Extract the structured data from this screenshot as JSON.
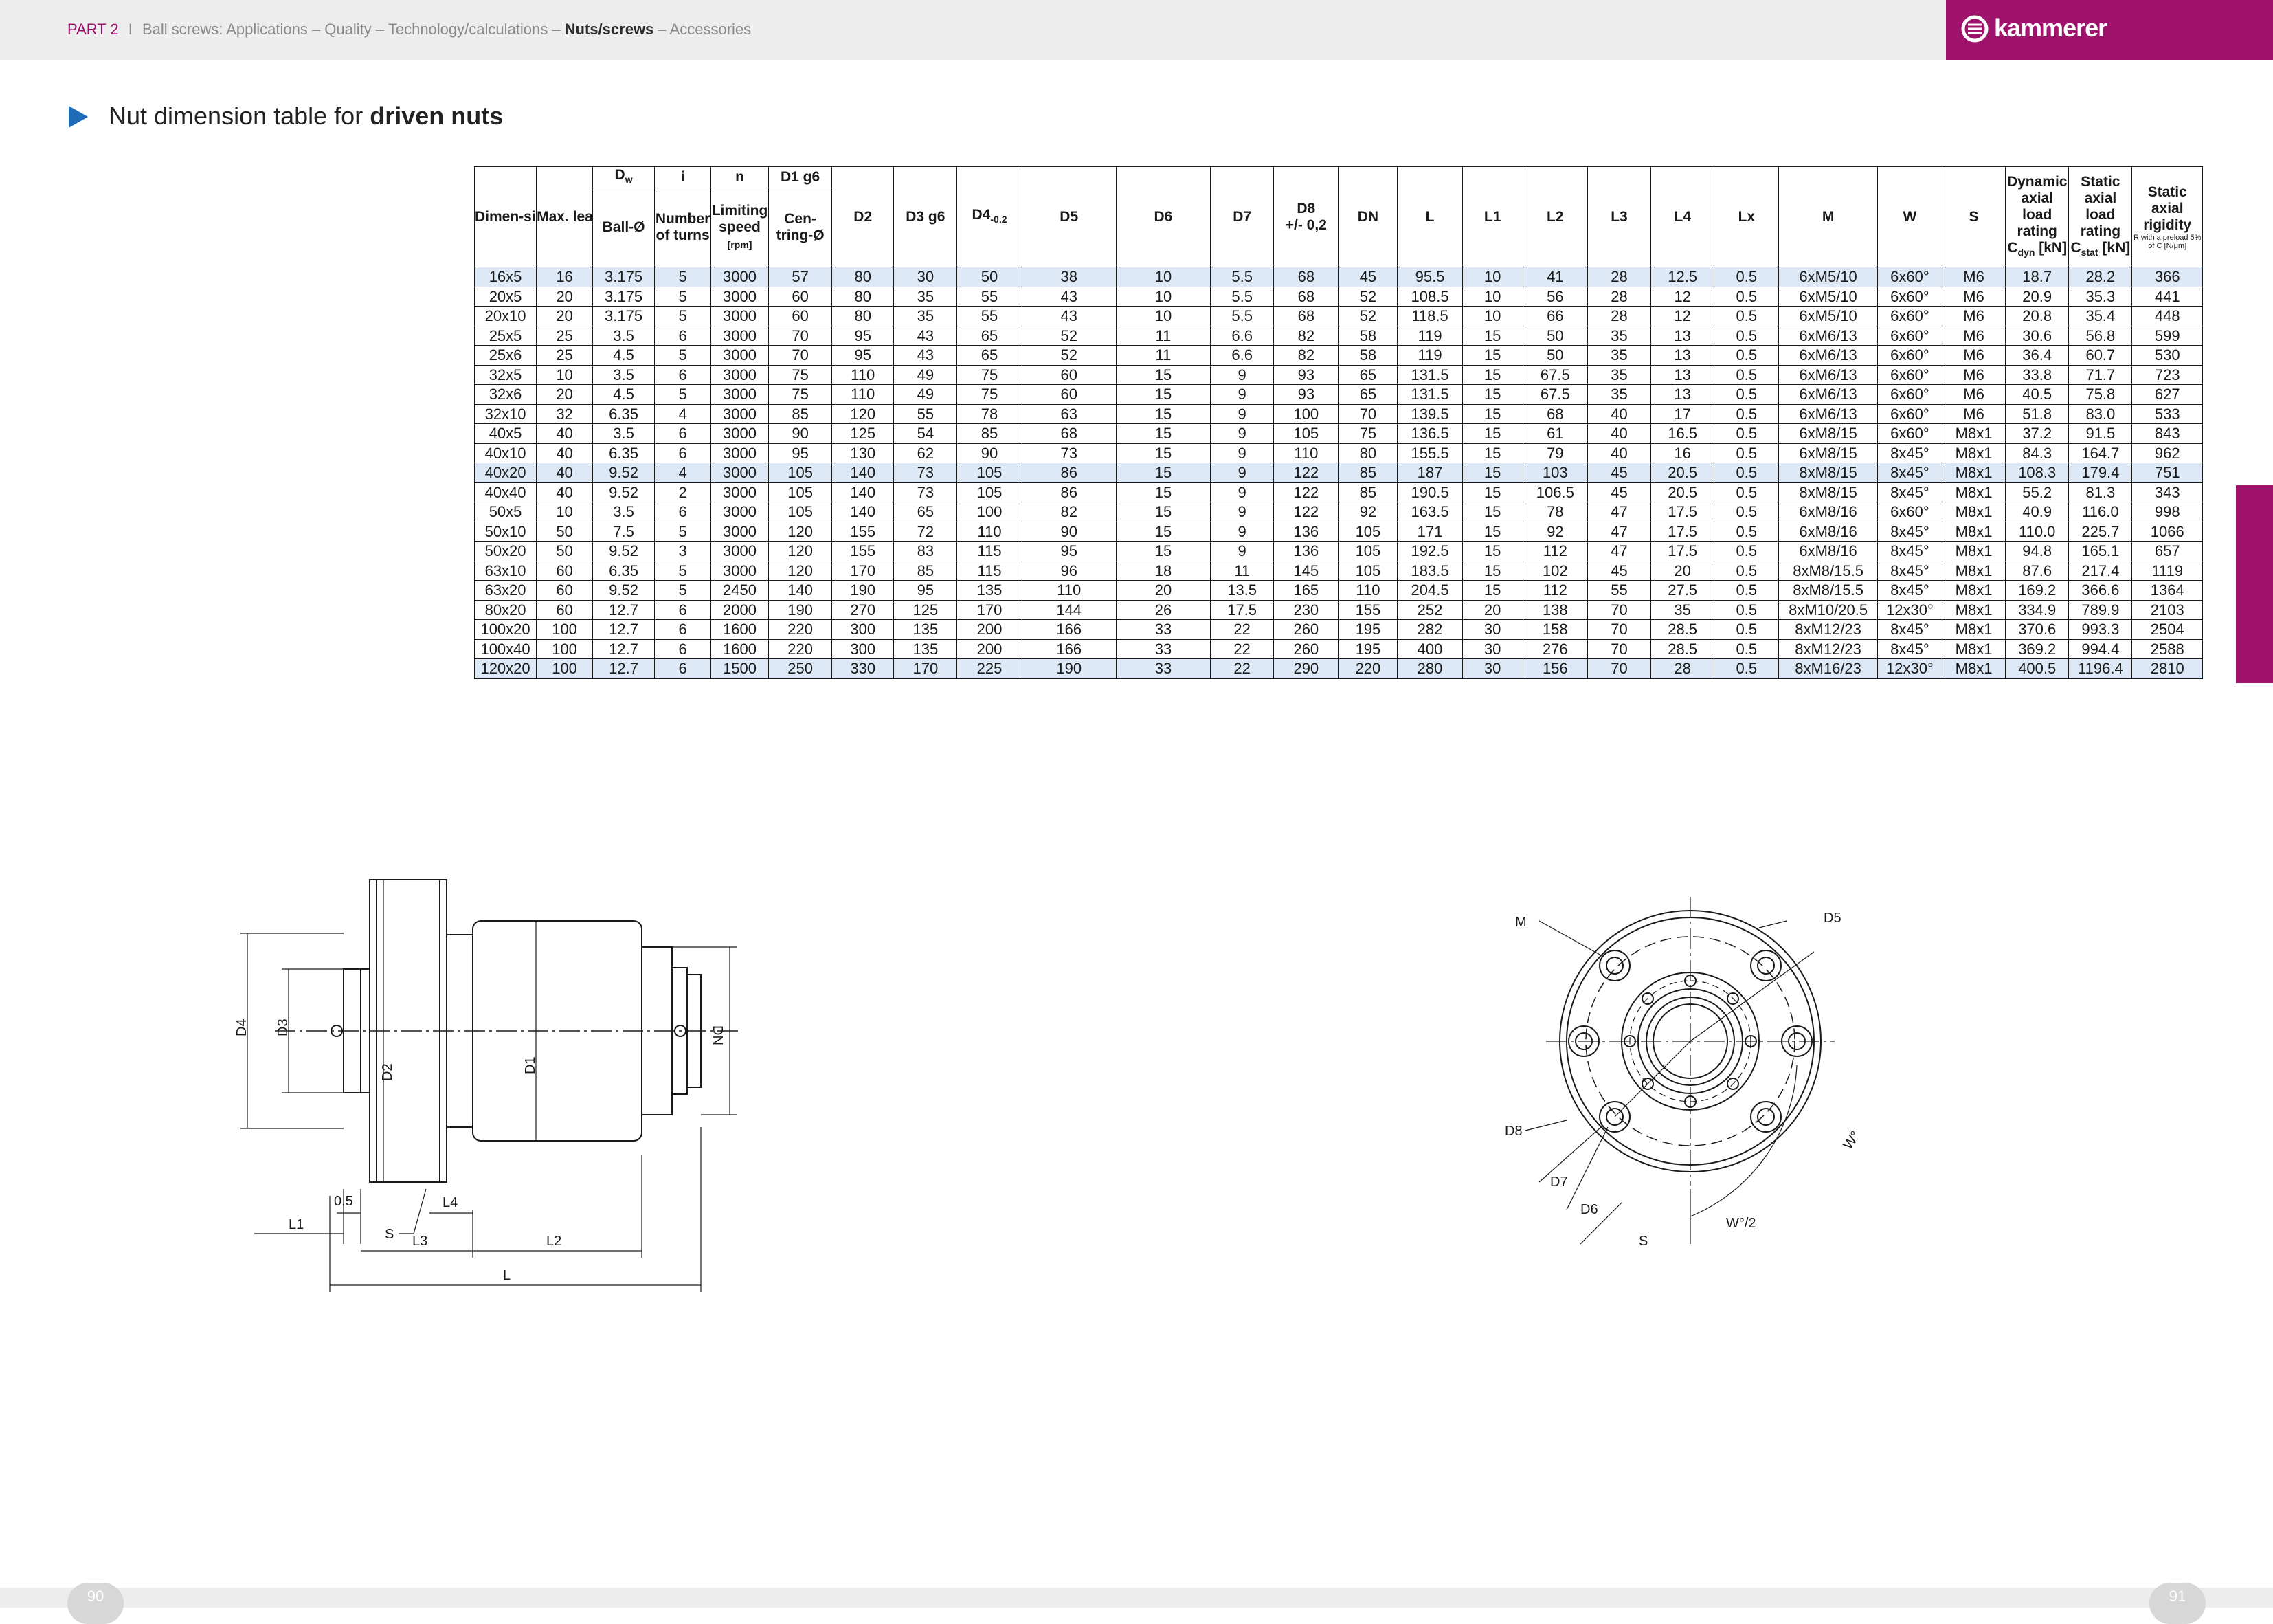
{
  "header": {
    "part": "PART 2",
    "separator": "I",
    "crumbs_lead": "Ball screws: Applications – Quality – Technology/calculations – ",
    "active": "Nuts/screws",
    "crumbs_tail": " – Accessories",
    "logo_text": "kammerer",
    "brand_color": "#a0136d"
  },
  "title": {
    "prefix": "Nut dimension table for ",
    "bold": "driven nuts"
  },
  "table": {
    "group_headers": {
      "dw": "D",
      "dw_sub": "w",
      "i": "i",
      "n": "n",
      "d1": "D1 g6"
    },
    "headers": {
      "dimensions": "Dimen-sions",
      "max_lead": "Max. lead",
      "ball": "Ball-Ø",
      "turns": "Number of turns",
      "speed": "Limiting speed",
      "speed_unit": "[rpm]",
      "centring": "Cen-tring-Ø",
      "d2": "D2",
      "d3": "D3 g6",
      "d4": "D4",
      "d4_sub": "-0.2",
      "d5": "D5",
      "d6": "D6",
      "d7": "D7",
      "d8": "D8",
      "d8_tol": "+/- 0,2",
      "dn": "DN",
      "l": "L",
      "l1": "L1",
      "l2": "L2",
      "l3": "L3",
      "l4": "L4",
      "lx": "Lx",
      "m": "M",
      "w": "W",
      "s": "S",
      "dyn": "Dynamic axial load rating",
      "dyn_unit": "C",
      "dyn_sub": "dyn",
      "dyn_unit2": " [kN]",
      "stat": "Static axial load rating",
      "stat_unit": "C",
      "stat_sub": "stat",
      "stat_unit2": " [kN]",
      "rig": "Static axial rigidity",
      "rig_note": "R with a preload 5% of C [N/μm]"
    },
    "rows": [
      [
        "16x5",
        "16",
        "3.175",
        "5",
        "3000",
        "57",
        "80",
        "30",
        "50",
        "38",
        "10",
        "5.5",
        "68",
        "45",
        "95.5",
        "10",
        "41",
        "28",
        "12.5",
        "0.5",
        "6xM5/10",
        "6x60°",
        "M6",
        "18.7",
        "28.2",
        "366"
      ],
      [
        "20x5",
        "20",
        "3.175",
        "5",
        "3000",
        "60",
        "80",
        "35",
        "55",
        "43",
        "10",
        "5.5",
        "68",
        "52",
        "108.5",
        "10",
        "56",
        "28",
        "12",
        "0.5",
        "6xM5/10",
        "6x60°",
        "M6",
        "20.9",
        "35.3",
        "441"
      ],
      [
        "20x10",
        "20",
        "3.175",
        "5",
        "3000",
        "60",
        "80",
        "35",
        "55",
        "43",
        "10",
        "5.5",
        "68",
        "52",
        "118.5",
        "10",
        "66",
        "28",
        "12",
        "0.5",
        "6xM5/10",
        "6x60°",
        "M6",
        "20.8",
        "35.4",
        "448"
      ],
      [
        "25x5",
        "25",
        "3.5",
        "6",
        "3000",
        "70",
        "95",
        "43",
        "65",
        "52",
        "11",
        "6.6",
        "82",
        "58",
        "119",
        "15",
        "50",
        "35",
        "13",
        "0.5",
        "6xM6/13",
        "6x60°",
        "M6",
        "30.6",
        "56.8",
        "599"
      ],
      [
        "25x6",
        "25",
        "4.5",
        "5",
        "3000",
        "70",
        "95",
        "43",
        "65",
        "52",
        "11",
        "6.6",
        "82",
        "58",
        "119",
        "15",
        "50",
        "35",
        "13",
        "0.5",
        "6xM6/13",
        "6x60°",
        "M6",
        "36.4",
        "60.7",
        "530"
      ],
      [
        "32x5",
        "10",
        "3.5",
        "6",
        "3000",
        "75",
        "110",
        "49",
        "75",
        "60",
        "15",
        "9",
        "93",
        "65",
        "131.5",
        "15",
        "67.5",
        "35",
        "13",
        "0.5",
        "6xM6/13",
        "6x60°",
        "M6",
        "33.8",
        "71.7",
        "723"
      ],
      [
        "32x6",
        "20",
        "4.5",
        "5",
        "3000",
        "75",
        "110",
        "49",
        "75",
        "60",
        "15",
        "9",
        "93",
        "65",
        "131.5",
        "15",
        "67.5",
        "35",
        "13",
        "0.5",
        "6xM6/13",
        "6x60°",
        "M6",
        "40.5",
        "75.8",
        "627"
      ],
      [
        "32x10",
        "32",
        "6.35",
        "4",
        "3000",
        "85",
        "120",
        "55",
        "78",
        "63",
        "15",
        "9",
        "100",
        "70",
        "139.5",
        "15",
        "68",
        "40",
        "17",
        "0.5",
        "6xM6/13",
        "6x60°",
        "M6",
        "51.8",
        "83.0",
        "533"
      ],
      [
        "40x5",
        "40",
        "3.5",
        "6",
        "3000",
        "90",
        "125",
        "54",
        "85",
        "68",
        "15",
        "9",
        "105",
        "75",
        "136.5",
        "15",
        "61",
        "40",
        "16.5",
        "0.5",
        "6xM8/15",
        "6x60°",
        "M8x1",
        "37.2",
        "91.5",
        "843"
      ],
      [
        "40x10",
        "40",
        "6.35",
        "6",
        "3000",
        "95",
        "130",
        "62",
        "90",
        "73",
        "15",
        "9",
        "110",
        "80",
        "155.5",
        "15",
        "79",
        "40",
        "16",
        "0.5",
        "6xM8/15",
        "8x45°",
        "M8x1",
        "84.3",
        "164.7",
        "962"
      ],
      [
        "40x20",
        "40",
        "9.52",
        "4",
        "3000",
        "105",
        "140",
        "73",
        "105",
        "86",
        "15",
        "9",
        "122",
        "85",
        "187",
        "15",
        "103",
        "45",
        "20.5",
        "0.5",
        "8xM8/15",
        "8x45°",
        "M8x1",
        "108.3",
        "179.4",
        "751"
      ],
      [
        "40x40",
        "40",
        "9.52",
        "2",
        "3000",
        "105",
        "140",
        "73",
        "105",
        "86",
        "15",
        "9",
        "122",
        "85",
        "190.5",
        "15",
        "106.5",
        "45",
        "20.5",
        "0.5",
        "8xM8/15",
        "8x45°",
        "M8x1",
        "55.2",
        "81.3",
        "343"
      ],
      [
        "50x5",
        "10",
        "3.5",
        "6",
        "3000",
        "105",
        "140",
        "65",
        "100",
        "82",
        "15",
        "9",
        "122",
        "92",
        "163.5",
        "15",
        "78",
        "47",
        "17.5",
        "0.5",
        "6xM8/16",
        "6x60°",
        "M8x1",
        "40.9",
        "116.0",
        "998"
      ],
      [
        "50x10",
        "50",
        "7.5",
        "5",
        "3000",
        "120",
        "155",
        "72",
        "110",
        "90",
        "15",
        "9",
        "136",
        "105",
        "171",
        "15",
        "92",
        "47",
        "17.5",
        "0.5",
        "6xM8/16",
        "8x45°",
        "M8x1",
        "110.0",
        "225.7",
        "1066"
      ],
      [
        "50x20",
        "50",
        "9.52",
        "3",
        "3000",
        "120",
        "155",
        "83",
        "115",
        "95",
        "15",
        "9",
        "136",
        "105",
        "192.5",
        "15",
        "112",
        "47",
        "17.5",
        "0.5",
        "6xM8/16",
        "8x45°",
        "M8x1",
        "94.8",
        "165.1",
        "657"
      ],
      [
        "63x10",
        "60",
        "6.35",
        "5",
        "3000",
        "120",
        "170",
        "85",
        "115",
        "96",
        "18",
        "11",
        "145",
        "105",
        "183.5",
        "15",
        "102",
        "45",
        "20",
        "0.5",
        "8xM8/15.5",
        "8x45°",
        "M8x1",
        "87.6",
        "217.4",
        "1119"
      ],
      [
        "63x20",
        "60",
        "9.52",
        "5",
        "2450",
        "140",
        "190",
        "95",
        "135",
        "110",
        "20",
        "13.5",
        "165",
        "110",
        "204.5",
        "15",
        "112",
        "55",
        "27.5",
        "0.5",
        "8xM8/15.5",
        "8x45°",
        "M8x1",
        "169.2",
        "366.6",
        "1364"
      ],
      [
        "80x20",
        "60",
        "12.7",
        "6",
        "2000",
        "190",
        "270",
        "125",
        "170",
        "144",
        "26",
        "17.5",
        "230",
        "155",
        "252",
        "20",
        "138",
        "70",
        "35",
        "0.5",
        "8xM10/20.5",
        "12x30°",
        "M8x1",
        "334.9",
        "789.9",
        "2103"
      ],
      [
        "100x20",
        "100",
        "12.7",
        "6",
        "1600",
        "220",
        "300",
        "135",
        "200",
        "166",
        "33",
        "22",
        "260",
        "195",
        "282",
        "30",
        "158",
        "70",
        "28.5",
        "0.5",
        "8xM12/23",
        "8x45°",
        "M8x1",
        "370.6",
        "993.3",
        "2504"
      ],
      [
        "100x40",
        "100",
        "12.7",
        "6",
        "1600",
        "220",
        "300",
        "135",
        "200",
        "166",
        "33",
        "22",
        "260",
        "195",
        "400",
        "30",
        "276",
        "70",
        "28.5",
        "0.5",
        "8xM12/23",
        "8x45°",
        "M8x1",
        "369.2",
        "994.4",
        "2588"
      ],
      [
        "120x20",
        "100",
        "12.7",
        "6",
        "1500",
        "250",
        "330",
        "170",
        "225",
        "190",
        "33",
        "22",
        "290",
        "220",
        "280",
        "30",
        "156",
        "70",
        "28",
        "0.5",
        "8xM16/23",
        "12x30°",
        "M8x1",
        "400.5",
        "1196.4",
        "2810"
      ]
    ],
    "highlighted_rows": [
      0,
      10,
      20
    ],
    "highlight_color": "#dde9f6"
  },
  "drawing_side": {
    "labels": {
      "d4": "D4",
      "d3": "D3",
      "d2": "D2",
      "d1": "D1",
      "dn": "DN",
      "l1": "L1",
      "dim_05": "0.5",
      "s": "S",
      "l4": "L4",
      "l3": "L3",
      "l2": "L2",
      "l": "L"
    }
  },
  "drawing_front": {
    "labels": {
      "m": "M",
      "d5": "D5",
      "d8": "D8",
      "d7": "D7",
      "d6": "D6",
      "s": "S",
      "w": "W°",
      "w_half": "W°/2"
    }
  },
  "pages": {
    "left": "90",
    "right": "91"
  }
}
